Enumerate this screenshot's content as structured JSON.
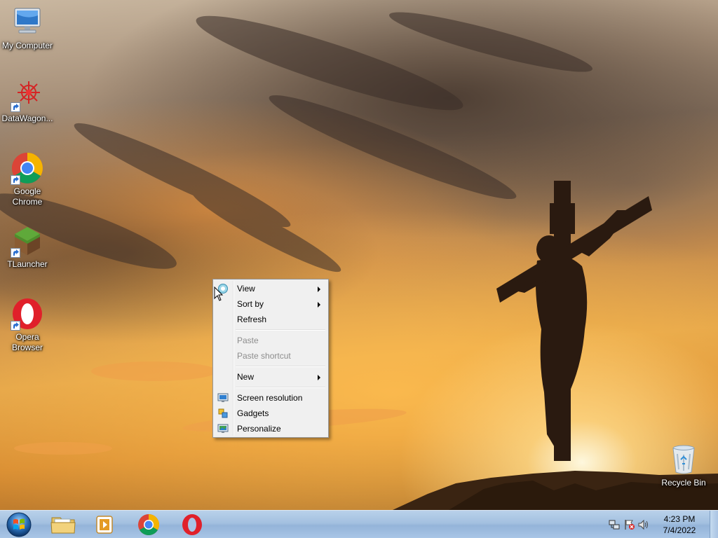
{
  "desktop_icons": [
    {
      "label": "My Computer",
      "icon": "computer-icon"
    },
    {
      "label": "DataWagon...",
      "icon": "datawagon-icon"
    },
    {
      "label": "Google Chrome",
      "icon": "chrome-icon"
    },
    {
      "label": "TLauncher",
      "icon": "tlauncher-icon"
    },
    {
      "label": "Opera Browser",
      "icon": "opera-icon"
    },
    {
      "label": "Recycle Bin",
      "icon": "recycle-bin-icon"
    }
  ],
  "context_menu": {
    "view": "View",
    "sort_by": "Sort by",
    "refresh": "Refresh",
    "paste": "Paste",
    "paste_shortcut": "Paste shortcut",
    "new": "New",
    "screen_resolution": "Screen resolution",
    "gadgets": "Gadgets",
    "personalize": "Personalize"
  },
  "taskbar": {
    "pinned": [
      {
        "name": "Windows Explorer",
        "icon": "folder-icon"
      },
      {
        "name": "Windows Media Player",
        "icon": "media-player-icon"
      },
      {
        "name": "Google Chrome",
        "icon": "chrome-icon"
      },
      {
        "name": "Opera",
        "icon": "opera-icon"
      }
    ],
    "clock": {
      "time": "4:23 PM",
      "date": "7/4/2022"
    },
    "tray_icons": [
      "network-icon",
      "action-center-icon",
      "volume-icon"
    ]
  },
  "colors": {
    "taskbar": "#a3c0e0",
    "menu_bg": "#f0f0f0",
    "chrome_red": "#db4437",
    "chrome_green": "#0f9d58",
    "chrome_yellow": "#f4b400",
    "chrome_blue": "#4285f4",
    "opera_red": "#e0202a"
  }
}
